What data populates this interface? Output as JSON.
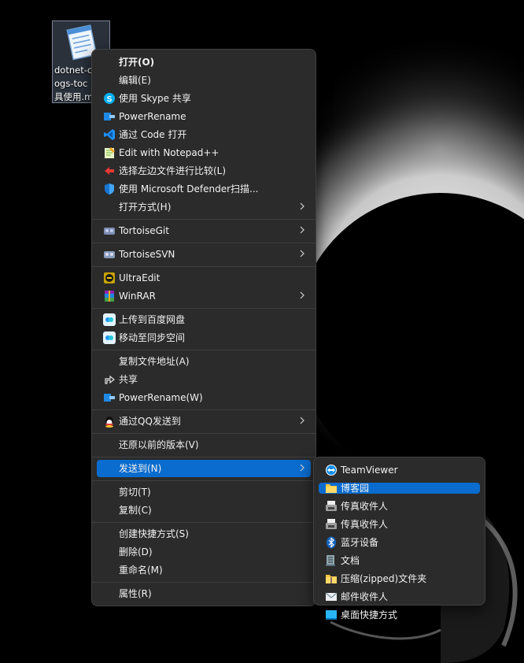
{
  "desktop": {
    "file_label": "dotnet-c\nogs-toc\n具使用.m"
  },
  "context_menu": {
    "items": [
      {
        "label": "打开(O)",
        "icon": "none",
        "bold": true
      },
      {
        "label": "编辑(E)",
        "icon": "none"
      },
      {
        "label": "使用 Skype 共享",
        "icon": "skype-icon"
      },
      {
        "label": "PowerRename",
        "icon": "powerrename-icon"
      },
      {
        "label": "通过 Code 打开",
        "icon": "vscode-icon"
      },
      {
        "label": "Edit with Notepad++",
        "icon": "notepadpp-icon"
      },
      {
        "label": "选择左边文件进行比较(L)",
        "icon": "compare-icon"
      },
      {
        "label": "使用 Microsoft Defender扫描...",
        "icon": "defender-shield-icon"
      },
      {
        "label": "打开方式(H)",
        "icon": "none",
        "submenu": true
      },
      {
        "label": "TortoiseGit",
        "icon": "tortoisegit-icon",
        "submenu": true
      },
      {
        "label": "TortoiseSVN",
        "icon": "tortoisesvn-icon",
        "submenu": true
      },
      {
        "label": "UltraEdit",
        "icon": "ultraedit-icon"
      },
      {
        "label": "WinRAR",
        "icon": "winrar-icon",
        "submenu": true
      },
      {
        "label": "上传到百度网盘",
        "icon": "baidu-netdisk-icon"
      },
      {
        "label": "移动至同步空间",
        "icon": "baidu-sync-icon"
      },
      {
        "label": "复制文件地址(A)",
        "icon": "none"
      },
      {
        "label": "共享",
        "icon": "share-icon"
      },
      {
        "label": "PowerRename(W)",
        "icon": "powerrename-icon"
      },
      {
        "label": "通过QQ发送到",
        "icon": "qq-icon",
        "submenu": true
      },
      {
        "label": "还原以前的版本(V)",
        "icon": "none"
      },
      {
        "label": "发送到(N)",
        "icon": "none",
        "submenu": true,
        "highlighted": true
      },
      {
        "label": "剪切(T)",
        "icon": "none"
      },
      {
        "label": "复制(C)",
        "icon": "none"
      },
      {
        "label": "创建快捷方式(S)",
        "icon": "none"
      },
      {
        "label": "删除(D)",
        "icon": "none"
      },
      {
        "label": "重命名(M)",
        "icon": "none"
      },
      {
        "label": "属性(R)",
        "icon": "none"
      }
    ]
  },
  "send_to_menu": {
    "items": [
      {
        "label": "TeamViewer",
        "icon": "teamviewer-icon"
      },
      {
        "label": "博客园",
        "icon": "folder-icon",
        "highlighted": true
      },
      {
        "label": "传真收件人",
        "icon": "fax-icon"
      },
      {
        "label": "传真收件人",
        "icon": "fax-icon"
      },
      {
        "label": "蓝牙设备",
        "icon": "bluetooth-icon"
      },
      {
        "label": "文档",
        "icon": "document-icon"
      },
      {
        "label": "压缩(zipped)文件夹",
        "icon": "zip-folder-icon"
      },
      {
        "label": "邮件收件人",
        "icon": "mail-icon"
      },
      {
        "label": "桌面快捷方式",
        "icon": "desktop-icon"
      }
    ]
  },
  "colors": {
    "menu_bg": "#2b2b2b",
    "highlight": "#0a6cce",
    "separator": "#3f3f3f",
    "text": "#f2f2f2"
  }
}
